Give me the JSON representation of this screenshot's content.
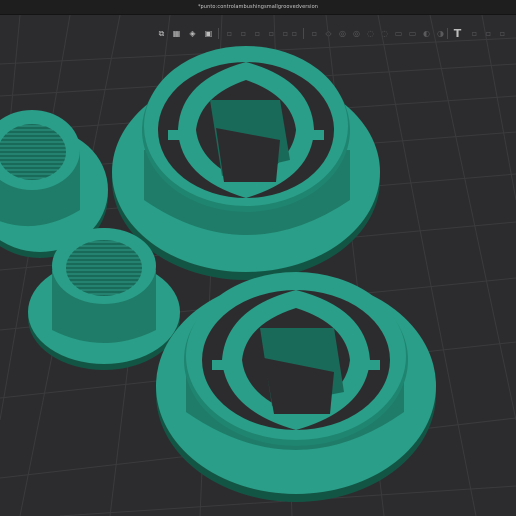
{
  "window": {
    "title": "*punto:controlambushingsmallgroovedversion"
  },
  "toolbar": {
    "buttons": [
      {
        "name": "view-cube-icon",
        "glyph": "⧉",
        "enabled": true
      },
      {
        "name": "grid-icon",
        "glyph": "▦",
        "enabled": true
      },
      {
        "name": "appearance-icon",
        "glyph": "◈",
        "enabled": true
      },
      {
        "name": "image-icon",
        "glyph": "▣",
        "enabled": true
      },
      {
        "name": "tool-icon",
        "glyph": "▫",
        "enabled": false
      },
      {
        "name": "tool-icon",
        "glyph": "▫",
        "enabled": false
      },
      {
        "name": "tool-icon",
        "glyph": "▫",
        "enabled": false
      },
      {
        "name": "tool-icon",
        "glyph": "▫",
        "enabled": false
      },
      {
        "name": "tool-icon",
        "glyph": "▫",
        "enabled": false
      },
      {
        "name": "tool-icon",
        "glyph": "▫",
        "enabled": false
      },
      {
        "name": "tool-icon",
        "glyph": "▫",
        "enabled": false
      },
      {
        "name": "tool-icon",
        "glyph": "◇",
        "enabled": false
      },
      {
        "name": "tool-icon",
        "glyph": "◎",
        "enabled": false
      },
      {
        "name": "tool-icon",
        "glyph": "◎",
        "enabled": false
      },
      {
        "name": "tool-icon",
        "glyph": "◌",
        "enabled": false
      },
      {
        "name": "tool-icon",
        "glyph": "◌",
        "enabled": false
      },
      {
        "name": "tool-icon",
        "glyph": "▭",
        "enabled": false
      },
      {
        "name": "tool-icon",
        "glyph": "▭",
        "enabled": false
      },
      {
        "name": "tool-icon",
        "glyph": "◐",
        "enabled": false
      },
      {
        "name": "tool-icon",
        "glyph": "◑",
        "enabled": false
      },
      {
        "name": "text-tool-icon",
        "glyph": "T",
        "enabled": true
      },
      {
        "name": "tool-icon",
        "glyph": "▫",
        "enabled": false
      },
      {
        "name": "tool-icon",
        "glyph": "▫",
        "enabled": false
      },
      {
        "name": "tool-icon",
        "glyph": "▫",
        "enabled": false
      }
    ]
  },
  "colors": {
    "background": "#2c2c2e",
    "grid": "#3a3a3d",
    "model_top": "#2a9e88",
    "model_side": "#1e7c69",
    "model_dark": "#135545",
    "model_shade": "#0f4538"
  }
}
